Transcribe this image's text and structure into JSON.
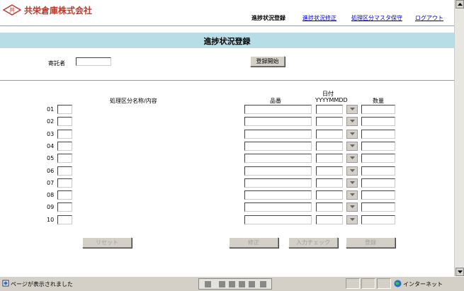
{
  "header": {
    "logo_text": "共",
    "company": "共栄倉庫株式会社",
    "nav": {
      "current": "進捗状況登録",
      "links": [
        "進捗状況修正",
        "処理区分マスタ保守",
        "ログアウト"
      ]
    }
  },
  "page_title": "進捗状況登録",
  "form": {
    "consignor_label": "寄託者",
    "consignor_value": "",
    "start_button": "登録開始"
  },
  "table": {
    "col_category": "処理区分名称/内容",
    "col_part": "品番",
    "col_date": "日付",
    "col_date_format": "YYYYMMDD",
    "col_qty": "数量",
    "rows": [
      "01",
      "02",
      "03",
      "04",
      "05",
      "06",
      "07",
      "08",
      "09",
      "10"
    ]
  },
  "buttons": {
    "reset": "リセット",
    "modify": "修正",
    "input_check": "入力チェック",
    "register": "登録"
  },
  "statusbar": {
    "message": "ページが表示されました",
    "zone": "インターネット"
  },
  "colors": {
    "band": "#b7dde6",
    "brand": "#c0392b",
    "link": "#0000cc"
  }
}
